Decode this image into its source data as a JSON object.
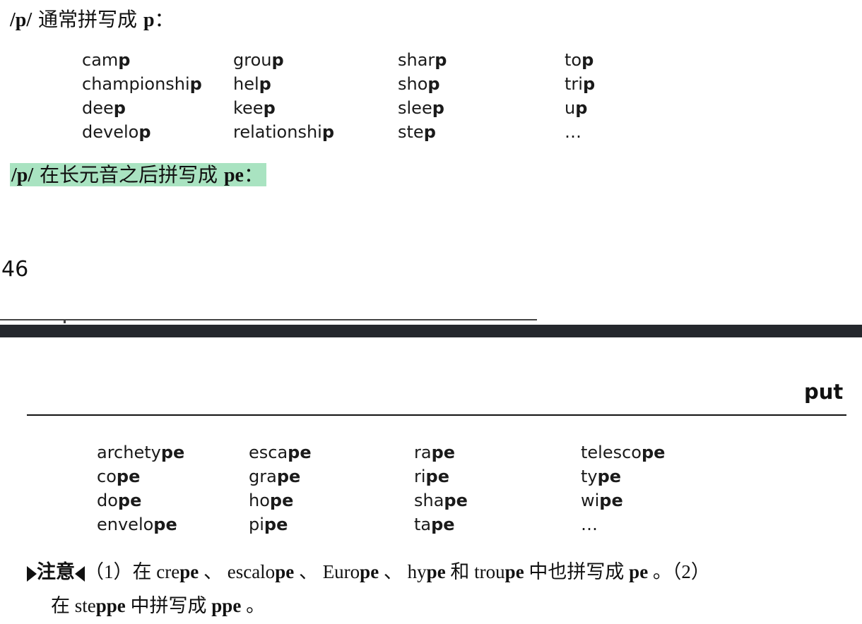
{
  "section1": {
    "heading_phoneme": "/p/",
    "heading_text": " 通常拼写成 ",
    "heading_spelling": "p",
    "heading_colon": "：",
    "words": [
      {
        "stem": "cam",
        "end": "p"
      },
      {
        "stem": "champion­shi",
        "end": "p"
      },
      {
        "stem": "dee",
        "end": "p"
      },
      {
        "stem": "develo",
        "end": "p"
      },
      {
        "stem": "grou",
        "end": "p"
      },
      {
        "stem": "hel",
        "end": "p"
      },
      {
        "stem": "kee",
        "end": "p"
      },
      {
        "stem": "relationshi",
        "end": "p"
      },
      {
        "stem": "shar",
        "end": "p"
      },
      {
        "stem": "sho",
        "end": "p"
      },
      {
        "stem": "slee",
        "end": "p"
      },
      {
        "stem": "ste",
        "end": "p"
      },
      {
        "stem": "to",
        "end": "p"
      },
      {
        "stem": "tri",
        "end": "p"
      },
      {
        "stem": "u",
        "end": "p"
      },
      {
        "stem": "…",
        "end": ""
      }
    ]
  },
  "section2": {
    "heading_phoneme": "/p/",
    "heading_text": " 在长元音之后拼写成 ",
    "heading_spelling": "pe",
    "heading_colon": "："
  },
  "page_number": "46",
  "running_head": "put",
  "section3": {
    "words": [
      {
        "stem": "archety",
        "end": "pe"
      },
      {
        "stem": "co",
        "end": "pe"
      },
      {
        "stem": "do",
        "end": "pe"
      },
      {
        "stem": "envelo",
        "end": "pe"
      },
      {
        "stem": "esca",
        "end": "pe"
      },
      {
        "stem": "gra",
        "end": "pe"
      },
      {
        "stem": "ho",
        "end": "pe"
      },
      {
        "stem": "pi",
        "end": "pe"
      },
      {
        "stem": "ra",
        "end": "pe"
      },
      {
        "stem": "ri",
        "end": "pe"
      },
      {
        "stem": "sha",
        "end": "pe"
      },
      {
        "stem": "ta",
        "end": "pe"
      },
      {
        "stem": "telesco",
        "end": "pe"
      },
      {
        "stem": "ty",
        "end": "pe"
      },
      {
        "stem": "wi",
        "end": "pe"
      },
      {
        "stem": "…",
        "end": ""
      }
    ]
  },
  "note": {
    "label": "注意",
    "p1": "（1）在 ",
    "w1_stem": "cre",
    "w1_end": "pe",
    "sep1": " 、 ",
    "w2_stem": "escalo",
    "w2_end": "pe",
    "sep2": " 、 ",
    "w3_stem": "Euro",
    "w3_end": "pe",
    "sep3": " 、 ",
    "w4_stem": "hy",
    "w4_end": "pe",
    "and": " 和 ",
    "w5_stem": "trou",
    "w5_end": "pe",
    "mid": " 中也拼写成 ",
    "sp1": "pe",
    "p2": " 。（2）",
    "line2_pre": "在 ",
    "w6_stem": "ste",
    "w6_end": "ppe",
    "line2_mid": " 中拼写成 ",
    "sp2": "ppe",
    "line2_end": " 。"
  }
}
